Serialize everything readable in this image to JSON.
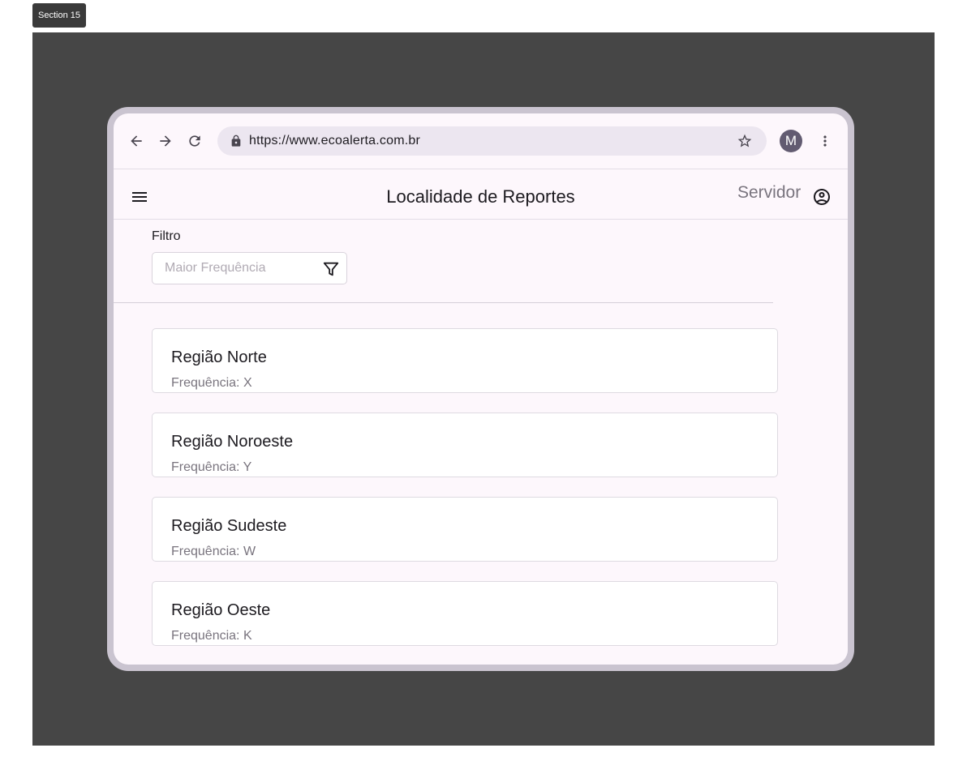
{
  "section": {
    "label": "Section 15"
  },
  "browser": {
    "url": "https://www.ecoalerta.com.br",
    "avatar_initial": "M",
    "icons": [
      "back-arrow-icon",
      "forward-arrow-icon",
      "reload-icon",
      "lock-icon",
      "star-icon",
      "more-vert-icon"
    ]
  },
  "appbar": {
    "title": "Localidade de Reportes",
    "user_label": "Servidor",
    "icons": [
      "menu-icon",
      "account-circle-icon"
    ]
  },
  "filter": {
    "label": "Filtro",
    "placeholder": "Maior Frequência",
    "value": "",
    "icon": "filter-icon"
  },
  "regions": [
    {
      "name": "Região Norte",
      "frequency": "Frequência: X"
    },
    {
      "name": "Região Noroeste",
      "frequency": "Frequência: Y"
    },
    {
      "name": "Região Sudeste",
      "frequency": "Frequência: W"
    },
    {
      "name": "Região Oeste",
      "frequency": "Frequência: K"
    }
  ],
  "colors": {
    "frame_background": "#464646",
    "device_border": "#cac4d0",
    "screen_background": "#fdf7fc",
    "urlbar_background": "#ece6f0",
    "avatar_background": "#625b71",
    "secondary_text": "#79747e"
  }
}
